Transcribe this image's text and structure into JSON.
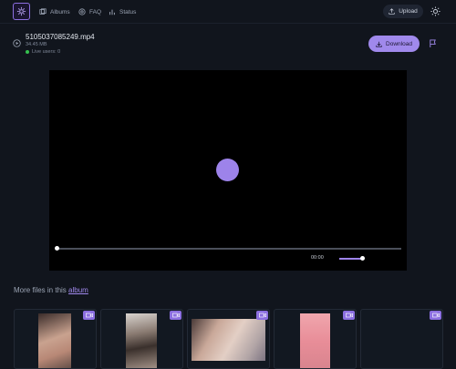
{
  "header": {
    "nav": [
      {
        "label": "Albums",
        "icon": "albums-icon"
      },
      {
        "label": "FAQ",
        "icon": "help-icon"
      },
      {
        "label": "Status",
        "icon": "status-icon"
      }
    ],
    "upload_label": "Upload",
    "theme_icon": "sun-icon"
  },
  "file": {
    "name": "5105037085249.mp4",
    "size": "34.45 MB",
    "live_users": "Live users: 0",
    "download_label": "Download"
  },
  "player": {
    "time": "00:00",
    "progress": 0,
    "volume": 1
  },
  "more_files": {
    "prefix": "More files in this",
    "link": "album"
  },
  "colors": {
    "background": "#11151d",
    "accent": "#a089ec",
    "live_dot": "#35c04f"
  }
}
